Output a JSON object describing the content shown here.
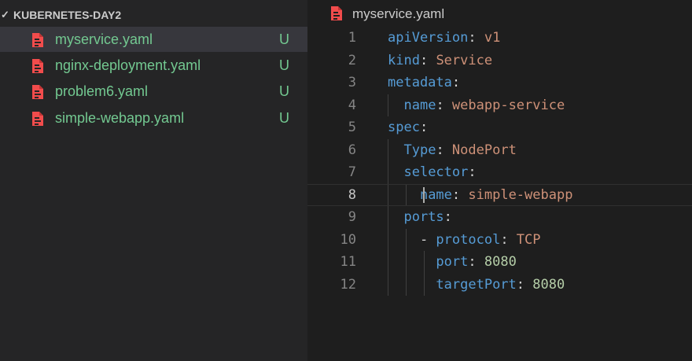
{
  "explorer": {
    "folder_name": "KUBERNETES-DAY2",
    "files": [
      {
        "name": "myservice.yaml",
        "status": "U",
        "selected": true
      },
      {
        "name": "nginx-deployment.yaml",
        "status": "U",
        "selected": false
      },
      {
        "name": "problem6.yaml",
        "status": "U",
        "selected": false
      },
      {
        "name": "simple-webapp.yaml",
        "status": "U",
        "selected": false
      }
    ]
  },
  "editor": {
    "breadcrumb_file": "myservice.yaml",
    "current_line": 8,
    "lines": [
      {
        "num": "1",
        "indent": "",
        "key": "apiVersion",
        "sep": ": ",
        "val": "v1",
        "val_type": "string"
      },
      {
        "num": "2",
        "indent": "",
        "key": "kind",
        "sep": ": ",
        "val": "Service",
        "val_type": "string"
      },
      {
        "num": "3",
        "indent": "",
        "key": "metadata",
        "sep": ":",
        "val": "",
        "val_type": ""
      },
      {
        "num": "4",
        "indent": "  ",
        "key": "name",
        "sep": ": ",
        "val": "webapp-service",
        "val_type": "string"
      },
      {
        "num": "5",
        "indent": "",
        "key": "spec",
        "sep": ":",
        "val": "",
        "val_type": ""
      },
      {
        "num": "6",
        "indent": "  ",
        "key": "Type",
        "sep": ": ",
        "val": "NodePort",
        "val_type": "string"
      },
      {
        "num": "7",
        "indent": "  ",
        "key": "selector",
        "sep": ":",
        "val": "",
        "val_type": ""
      },
      {
        "num": "8",
        "indent": "    ",
        "key": "name",
        "sep": ": ",
        "val": "simple-webapp",
        "val_type": "string"
      },
      {
        "num": "9",
        "indent": "  ",
        "key": "ports",
        "sep": ":",
        "val": "",
        "val_type": ""
      },
      {
        "num": "10",
        "indent": "    - ",
        "key": "protocol",
        "sep": ": ",
        "val": "TCP",
        "val_type": "string"
      },
      {
        "num": "11",
        "indent": "      ",
        "key": "port",
        "sep": ": ",
        "val": "8080",
        "val_type": "number"
      },
      {
        "num": "12",
        "indent": "      ",
        "key": "targetPort",
        "sep": ": ",
        "val": "8080",
        "val_type": "number"
      }
    ]
  },
  "colors": {
    "untracked_file": "#73c991",
    "yaml_key": "#569cd6",
    "yaml_string": "#ce9178",
    "yaml_number": "#b5cea8",
    "yaml_icon": "#f14c4c"
  },
  "icons": {
    "file_icon": "yaml-file-icon",
    "folder_toggle": "chevron-down-icon"
  }
}
